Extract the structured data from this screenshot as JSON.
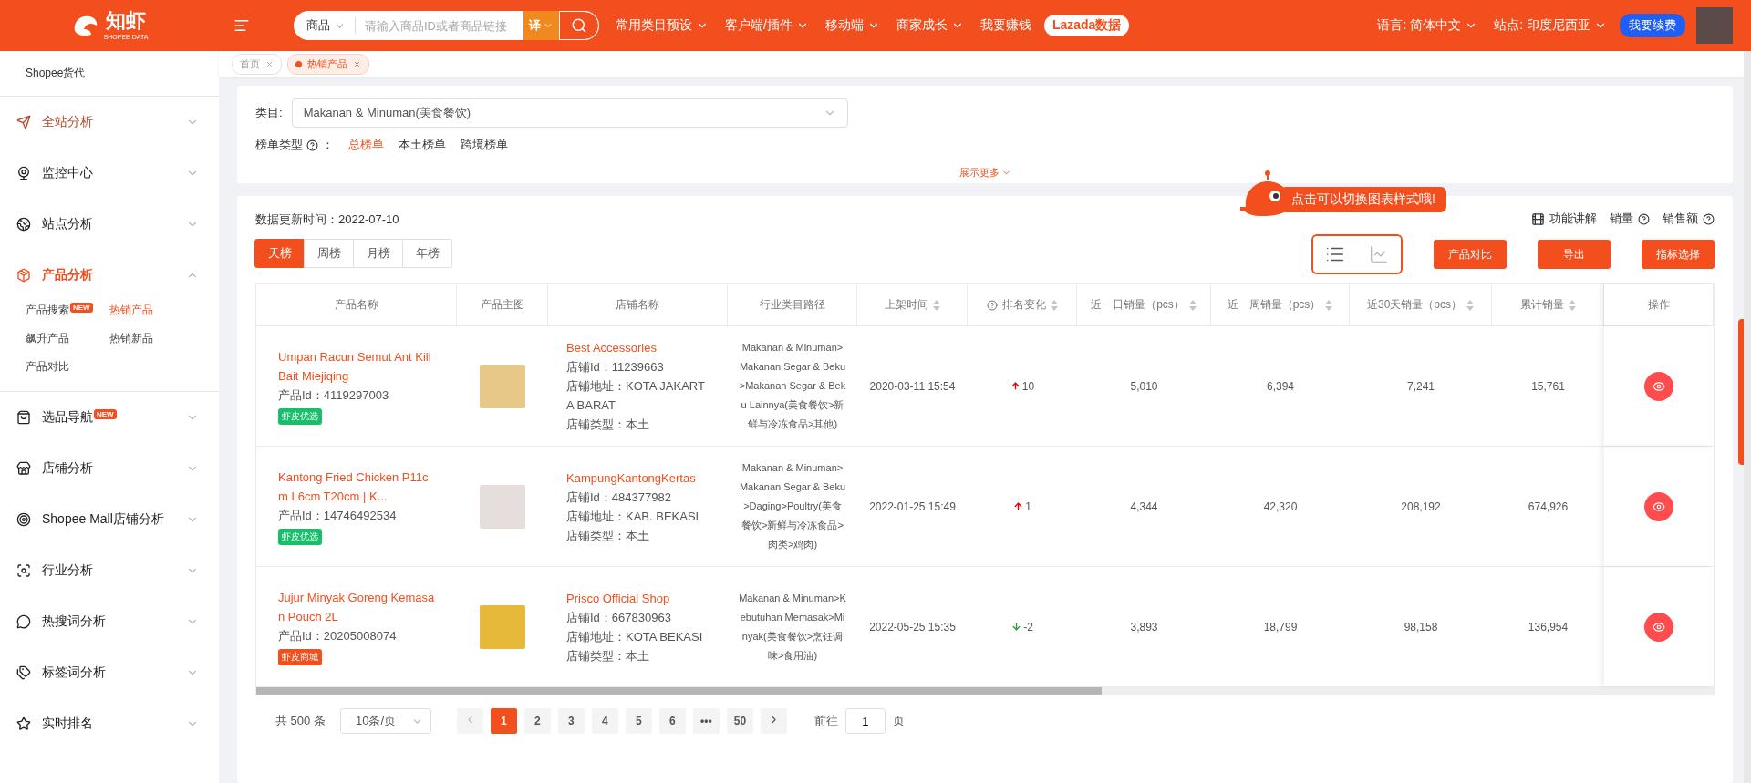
{
  "topbar": {
    "logo": "知虾",
    "logo_sub": "SHOPEE DATA",
    "search": {
      "scope": "商品",
      "placeholder": "请输入商品ID或者商品链接",
      "translate": "译"
    },
    "nav": [
      {
        "label": "常用类目预设",
        "dropdown": true
      },
      {
        "label": "客户端/插件",
        "dropdown": true
      },
      {
        "label": "移动端",
        "dropdown": true
      },
      {
        "label": "商家成长",
        "dropdown": true
      },
      {
        "label": "我要赚钱",
        "dropdown": false
      }
    ],
    "lazada": "Lazada数据",
    "language": "语言: 简体中文",
    "site": "站点: 印度尼西亚",
    "renew": "我要续费"
  },
  "sidebar": {
    "top_link": "Shopee货代",
    "groups": [
      {
        "label": "全站分析",
        "hovered": true,
        "selected": false,
        "expanded": false
      },
      {
        "label": "监控中心",
        "hovered": false,
        "selected": false,
        "expanded": false
      },
      {
        "label": "站点分析",
        "hovered": false,
        "selected": false,
        "expanded": false
      },
      {
        "label": "产品分析",
        "hovered": false,
        "selected": true,
        "expanded": true,
        "children": [
          {
            "label": "产品搜索",
            "badge": "NEW",
            "selected": false
          },
          {
            "label": "热销产品",
            "selected": true
          },
          {
            "label": "飙升产品",
            "selected": false
          },
          {
            "label": "热销新品",
            "selected": false
          },
          {
            "label": "产品对比",
            "selected": false
          }
        ]
      },
      {
        "label": "选品导航",
        "hovered": false,
        "selected": false,
        "expanded": false,
        "badge": "NEW"
      },
      {
        "label": "店铺分析",
        "hovered": false,
        "selected": false,
        "expanded": false
      },
      {
        "label": "Shopee Mall店铺分析",
        "hovered": false,
        "selected": false,
        "expanded": false
      },
      {
        "label": "行业分析",
        "hovered": false,
        "selected": false,
        "expanded": false
      },
      {
        "label": "热搜词分析",
        "hovered": false,
        "selected": false,
        "expanded": false
      },
      {
        "label": "标签词分析",
        "hovered": false,
        "selected": false,
        "expanded": false
      },
      {
        "label": "实时排名",
        "hovered": false,
        "selected": false,
        "expanded": false
      }
    ]
  },
  "page_tabs": [
    {
      "label": "首页",
      "selected": false
    },
    {
      "label": "热销产品",
      "selected": true
    }
  ],
  "filter": {
    "category_label": "类目:",
    "category_value": "Makanan & Minuman(美食餐饮)",
    "list_type_label": "榜单类型",
    "list_type_colon": "：",
    "options": [
      {
        "label": "总榜单",
        "selected": true
      },
      {
        "label": "本土榜单",
        "selected": false
      },
      {
        "label": "跨境榜单",
        "selected": false
      }
    ],
    "show_more": "展示更多"
  },
  "panel": {
    "update_time": "数据更新时间：2022-07-10",
    "tooltip": "点击可以切换图表样式哦!",
    "periods": [
      {
        "label": "天榜",
        "selected": true
      },
      {
        "label": "周榜",
        "selected": false
      },
      {
        "label": "月榜",
        "selected": false
      },
      {
        "label": "年榜",
        "selected": false
      }
    ],
    "view_modes": [
      {
        "kind": "list",
        "selected": true
      },
      {
        "kind": "chart",
        "selected": false
      }
    ],
    "help_links": [
      {
        "label": "功能讲解",
        "kind": "video"
      },
      {
        "label": "销量",
        "kind": "help"
      },
      {
        "label": "销售额",
        "kind": "help"
      }
    ],
    "buttons": [
      "产品对比",
      "导出",
      "指标选择"
    ]
  },
  "table": {
    "columns": [
      {
        "label": "产品名称",
        "sortable": false,
        "help": false
      },
      {
        "label": "产品主图",
        "sortable": false,
        "help": false
      },
      {
        "label": "店铺名称",
        "sortable": false,
        "help": false
      },
      {
        "label": "行业类目路径",
        "sortable": false,
        "help": false
      },
      {
        "label": "上架时间",
        "sortable": true,
        "help": false
      },
      {
        "label": "排名变化",
        "sortable": true,
        "help": true
      },
      {
        "label": "近一日销量（pcs）",
        "sortable": true,
        "help": false
      },
      {
        "label": "近一周销量（pcs）",
        "sortable": true,
        "help": false
      },
      {
        "label": "近30天销量（pcs）",
        "sortable": true,
        "help": false
      },
      {
        "label": "累计销量",
        "sortable": true,
        "help": false
      },
      {
        "label": "操作",
        "sortable": false,
        "help": false
      }
    ],
    "rows": [
      {
        "name": "Umpan Racun Semut Ant Kill Bait Miejiqing",
        "product_id": "产品Id：4119297003",
        "tag": {
          "label": "虾皮优选",
          "color": "#19be6b"
        },
        "store": "Best Accessories",
        "store_id": "店铺Id：11239663",
        "store_address": "店铺地址：KOTA JAKARTA BARAT",
        "store_type": "店铺类型：本土",
        "category": "Makanan & Minuman>Makanan Segar & Beku>Makanan Segar & Beku Lainnya(美食餐饮>新鲜与冷冻食品>其他)",
        "listed": "2020-03-11 15:54",
        "rank": {
          "kind": "up",
          "value": "10"
        },
        "day": "5,010",
        "week": "6,394",
        "month": "7,241",
        "total": "15,761"
      },
      {
        "name": "Kantong Fried Chicken P11cm L6cm T20cm | K...",
        "product_id": "产品Id：14746492534",
        "tag": {
          "label": "虾皮优选",
          "color": "#19be6b"
        },
        "store": "KampungKantongKertas",
        "store_id": "店铺Id：484377982",
        "store_address": "店铺地址：KAB. BEKASI",
        "store_type": "店铺类型：本土",
        "category": "Makanan & Minuman>Makanan Segar & Beku>Daging>Poultry(美食餐饮>新鲜与冷冻食品>肉类>鸡肉)",
        "listed": "2022-01-25 15:49",
        "rank": {
          "kind": "up",
          "value": "1"
        },
        "day": "4,344",
        "week": "42,320",
        "month": "208,192",
        "total": "674,926"
      },
      {
        "name": "Jujur Minyak Goreng Kemasan Pouch 2L",
        "product_id": "产品Id：20205008074",
        "tag": {
          "label": "虾皮商城",
          "color": "#f0501e"
        },
        "store": "Prisco Official Shop",
        "store_id": "店铺Id：667830963",
        "store_address": "店铺地址：KOTA BEKASI",
        "store_type": "店铺类型：本土",
        "category": "Makanan & Minuman>Kebutuhan Memasak>Minyak(美食餐饮>烹饪调味>食用油)",
        "listed": "2022-05-25 15:35",
        "rank": {
          "kind": "down",
          "value": "-2"
        },
        "day": "3,893",
        "week": "18,799",
        "month": "98,158",
        "total": "136,954"
      }
    ]
  },
  "pagination": {
    "total": "共 500 条",
    "page_size": "10条/页",
    "pages": [
      {
        "label": "1",
        "selected": true
      },
      {
        "label": "2",
        "selected": false
      },
      {
        "label": "3",
        "selected": false
      },
      {
        "label": "4",
        "selected": false
      },
      {
        "label": "5",
        "selected": false
      },
      {
        "label": "6",
        "selected": false
      },
      {
        "label": "•••",
        "selected": false
      },
      {
        "label": "50",
        "selected": false
      }
    ],
    "goto_label": "前往",
    "goto_value": "1",
    "page_unit": "页"
  }
}
